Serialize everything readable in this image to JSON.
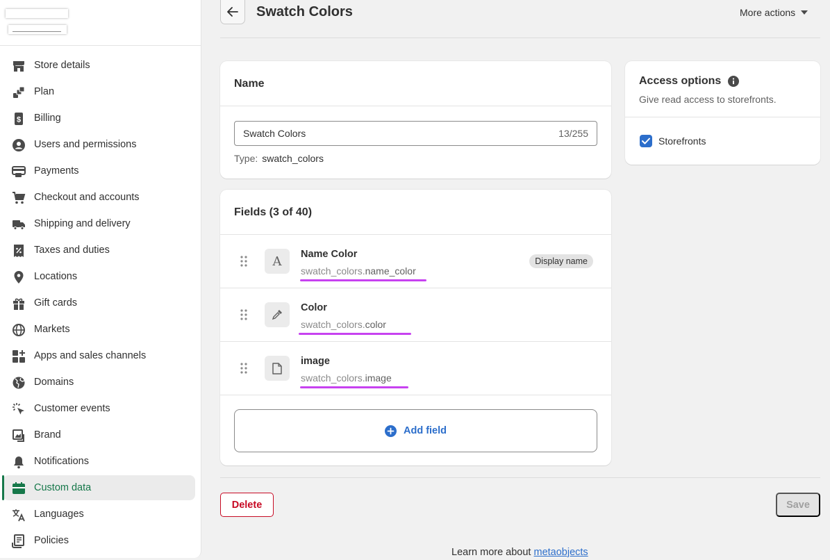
{
  "sidebar": {
    "items": [
      {
        "label": "Store details",
        "icon": "store-icon"
      },
      {
        "label": "Plan",
        "icon": "plan-icon"
      },
      {
        "label": "Billing",
        "icon": "billing-icon"
      },
      {
        "label": "Users and permissions",
        "icon": "user-icon"
      },
      {
        "label": "Payments",
        "icon": "payments-icon"
      },
      {
        "label": "Checkout and accounts",
        "icon": "cart-icon"
      },
      {
        "label": "Shipping and delivery",
        "icon": "truck-icon"
      },
      {
        "label": "Taxes and duties",
        "icon": "tax-icon"
      },
      {
        "label": "Locations",
        "icon": "location-icon"
      },
      {
        "label": "Gift cards",
        "icon": "gift-icon"
      },
      {
        "label": "Markets",
        "icon": "globe-icon"
      },
      {
        "label": "Apps and sales channels",
        "icon": "apps-icon"
      },
      {
        "label": "Domains",
        "icon": "domains-icon"
      },
      {
        "label": "Customer events",
        "icon": "cursor-icon"
      },
      {
        "label": "Brand",
        "icon": "brand-icon"
      },
      {
        "label": "Notifications",
        "icon": "bell-icon"
      },
      {
        "label": "Custom data",
        "icon": "custom-data-icon",
        "active": true
      },
      {
        "label": "Languages",
        "icon": "languages-icon"
      },
      {
        "label": "Policies",
        "icon": "policies-icon"
      }
    ]
  },
  "header": {
    "title": "Swatch Colors",
    "more_actions": "More actions"
  },
  "name_card": {
    "title": "Name",
    "input_value": "Swatch Colors",
    "char_count": "13/255",
    "type_label": "Type:",
    "type_value": "swatch_colors"
  },
  "fields_card": {
    "title": "Fields (3 of 40)",
    "fields": [
      {
        "name": "Name Color",
        "namespace": "swatch_colors.",
        "key": "name_color",
        "icon": "text-type-icon",
        "badge": "Display name"
      },
      {
        "name": "Color",
        "namespace": "swatch_colors.",
        "key": "color",
        "icon": "eyedropper-icon"
      },
      {
        "name": "image",
        "namespace": "swatch_colors.",
        "key": "image",
        "icon": "file-icon"
      }
    ],
    "add_field_label": "Add field"
  },
  "access_card": {
    "title": "Access options",
    "subtitle": "Give read access to storefronts.",
    "checkbox_label": "Storefronts",
    "checked": true
  },
  "footer": {
    "delete_label": "Delete",
    "save_label": "Save",
    "learn_prefix": "Learn more about ",
    "learn_link": "metaobjects"
  },
  "colors": {
    "accent": "#2c6ecb",
    "active_nav": "#16784a",
    "danger": "#c70a24",
    "annotation": "#c742f0"
  }
}
